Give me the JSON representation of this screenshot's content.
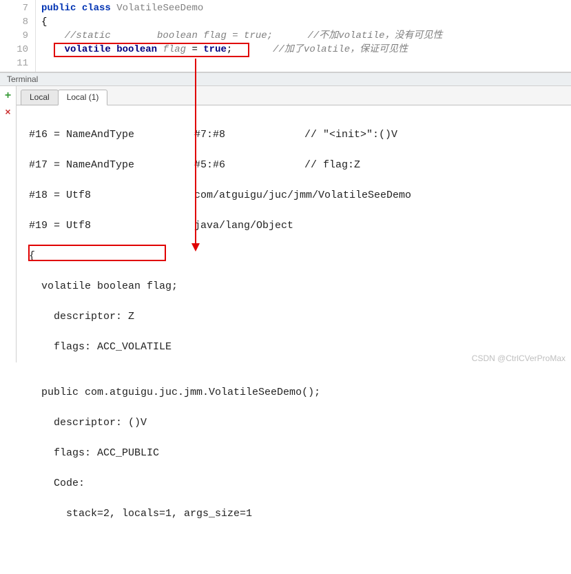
{
  "editor": {
    "lines": [
      "7",
      "8",
      "9",
      "10",
      "11"
    ],
    "l7_public": "public",
    "l7_class": "class",
    "l7_name": "VolatileSeeDemo",
    "l8_brace": "{",
    "l9_cmt1": "//static        boolean flag = true;",
    "l9_cmt2": "//不加volatile，没有可见性",
    "l10_volatile": "volatile",
    "l10_boolean": "boolean",
    "l10_flag": "flag",
    "l10_eq": "=",
    "l10_true": "true",
    "l10_semi": ";",
    "l10_cmt": "//加了volatile，保证可见性"
  },
  "terminal": {
    "title": "Terminal",
    "tabs": {
      "t0": "Local",
      "t1": "Local (1)"
    },
    "lines": {
      "r1a": "#16 = NameAndType",
      "r1b": "#7:#8",
      "r1c": "// \"<init>\":()V",
      "r2a": "#17 = NameAndType",
      "r2b": "#5:#6",
      "r2c": "// flag:Z",
      "r3a": "#18 = Utf8",
      "r3b": "com/atguigu/juc/jmm/VolatileSeeDemo",
      "r4a": "#19 = Utf8",
      "r4b": "java/lang/Object",
      "b1": "{",
      "b2": "  volatile boolean flag;",
      "b3": "    descriptor: Z",
      "b4": "    flags: ACC_VOLATILE",
      "b5": "",
      "b6": "  public com.atguigu.juc.jmm.VolatileSeeDemo();",
      "b7": "    descriptor: ()V",
      "b8": "    flags: ACC_PUBLIC",
      "b9": "    Code:",
      "b10": "      stack=2, locals=1, args_size=1"
    }
  },
  "watermark": "CSDN @CtrlCVerProMax"
}
